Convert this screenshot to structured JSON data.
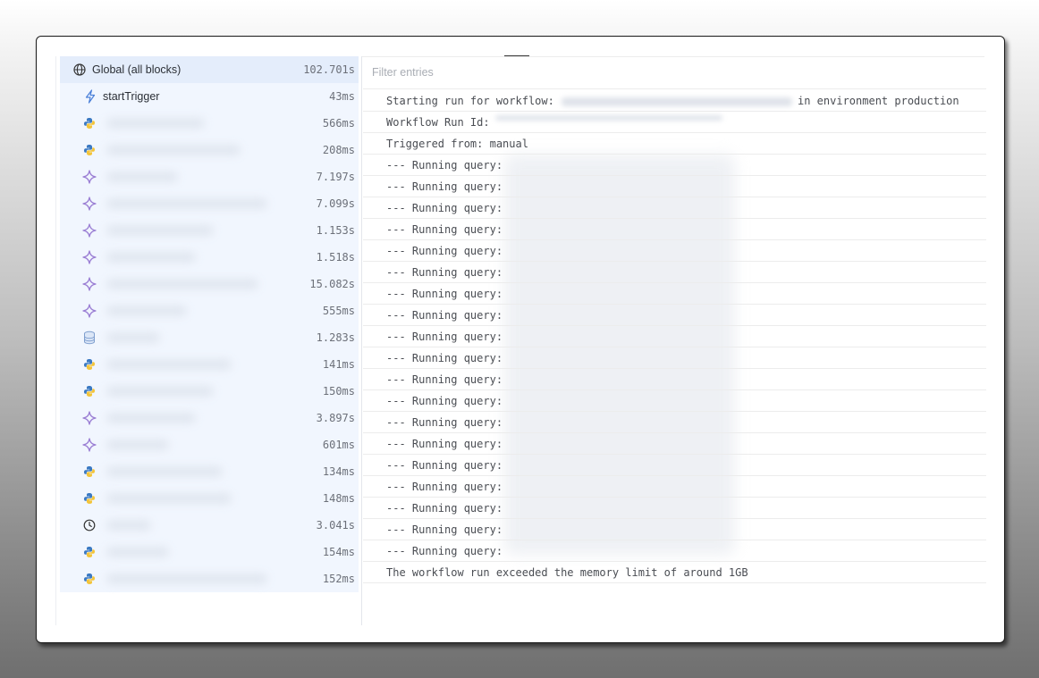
{
  "blocks": {
    "global": {
      "label": "Global (all blocks)",
      "duration": "102.701s",
      "icon": "globe-icon"
    },
    "items": [
      {
        "icon": "lightning-icon",
        "label": "startTrigger",
        "duration": "43ms"
      },
      {
        "icon": "python-icon",
        "label": "",
        "duration": "566ms"
      },
      {
        "icon": "python-icon",
        "label": "",
        "duration": "208ms"
      },
      {
        "icon": "sparkle-icon",
        "label": "",
        "duration": "7.197s"
      },
      {
        "icon": "sparkle-icon",
        "label": "",
        "duration": "7.099s"
      },
      {
        "icon": "sparkle-icon",
        "label": "",
        "duration": "1.153s"
      },
      {
        "icon": "sparkle-icon",
        "label": "",
        "duration": "1.518s"
      },
      {
        "icon": "sparkle-icon",
        "label": "",
        "duration": "15.082s"
      },
      {
        "icon": "sparkle-icon",
        "label": "",
        "duration": "555ms"
      },
      {
        "icon": "database-icon",
        "label": "",
        "duration": "1.283s"
      },
      {
        "icon": "python-icon",
        "label": "",
        "duration": "141ms"
      },
      {
        "icon": "python-icon",
        "label": "",
        "duration": "150ms"
      },
      {
        "icon": "sparkle-icon",
        "label": "",
        "duration": "3.897s"
      },
      {
        "icon": "sparkle-icon",
        "label": "",
        "duration": "601ms"
      },
      {
        "icon": "python-icon",
        "label": "",
        "duration": "134ms"
      },
      {
        "icon": "python-icon",
        "label": "",
        "duration": "148ms"
      },
      {
        "icon": "clock-icon",
        "label": "",
        "duration": "3.041s"
      },
      {
        "icon": "python-icon",
        "label": "",
        "duration": "154ms"
      },
      {
        "icon": "python-icon",
        "label": "",
        "duration": "152ms"
      }
    ]
  },
  "logs": {
    "filter_placeholder": "Filter entries",
    "entries": [
      {
        "text": "Starting run for workflow:",
        "suffix": "in environment production"
      },
      {
        "text": "Workflow Run Id:"
      },
      {
        "text": "Triggered from: manual"
      },
      {
        "text": "--- Running query:"
      },
      {
        "text": "--- Running query:"
      },
      {
        "text": "--- Running query:"
      },
      {
        "text": "--- Running query:"
      },
      {
        "text": "--- Running query:"
      },
      {
        "text": "--- Running query:"
      },
      {
        "text": "--- Running query:"
      },
      {
        "text": "--- Running query:"
      },
      {
        "text": "--- Running query:"
      },
      {
        "text": "--- Running query:"
      },
      {
        "text": "--- Running query:"
      },
      {
        "text": "--- Running query:"
      },
      {
        "text": "--- Running query:"
      },
      {
        "text": "--- Running query:"
      },
      {
        "text": "--- Running query:"
      },
      {
        "text": "--- Running query:"
      },
      {
        "text": "--- Running query:"
      },
      {
        "text": "--- Running query:"
      },
      {
        "text": "--- Running query:"
      },
      {
        "text": "The workflow run exceeded the memory limit of around 1GB"
      }
    ]
  },
  "colors": {
    "sparkle": "#9b7fd4",
    "lightning": "#4a7fd8",
    "python_blue": "#3b79c2",
    "python_yellow": "#f3c43a",
    "database": "#7f9fcf"
  }
}
